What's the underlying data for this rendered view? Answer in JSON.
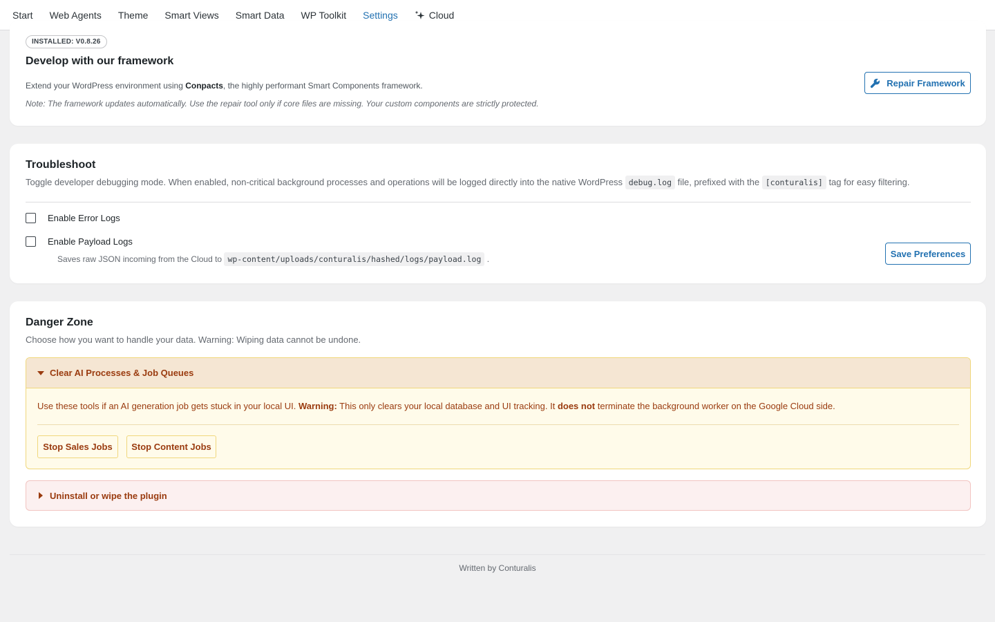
{
  "nav": {
    "tabs": [
      "Start",
      "Web Agents",
      "Theme",
      "Smart Views",
      "Smart Data",
      "WP Toolkit",
      "Settings",
      "Cloud"
    ],
    "active": "Settings",
    "cloud_icon": "sparkle-icon"
  },
  "framework": {
    "badge": "INSTALLED: V0.8.26",
    "title": "Develop with our framework",
    "desc_prefix": "Extend your WordPress environment using ",
    "desc_bold": "Conpacts",
    "desc_suffix": ", the highly performant Smart Components framework.",
    "note": "Note: The framework updates automatically. Use the repair tool only if core files are missing. Your custom components are strictly protected.",
    "repair_label": "Repair Framework",
    "repair_icon": "wrench-icon"
  },
  "troubleshoot": {
    "title": "Troubleshoot",
    "desc_1": "Toggle developer debugging mode. When enabled, non-critical background processes and operations will be logged directly into the native WordPress ",
    "code_1": "debug.log",
    "desc_2": " file, prefixed with the ",
    "code_2": "[conturalis]",
    "desc_3": " tag for easy filtering.",
    "error_logs_label": "Enable Error Logs",
    "error_logs_checked": false,
    "payload_logs_label": "Enable Payload Logs",
    "payload_logs_checked": false,
    "payload_hint_prefix": "Saves raw JSON incoming from the Cloud to ",
    "payload_hint_code": "wp-content/uploads/conturalis/hashed/logs/payload.log",
    "payload_hint_suffix": " .",
    "save_label": "Save Preferences"
  },
  "danger": {
    "title": "Danger Zone",
    "desc": "Choose how you want to handle your data. Warning: Wiping data cannot be undone.",
    "jobs_title": "Clear AI Processes & Job Queues",
    "jobs_text_1": "Use these tools if an AI generation job gets stuck in your local UI. ",
    "jobs_bold_1": "Warning:",
    "jobs_text_2": " This only clears your local database and UI tracking. It ",
    "jobs_bold_2": "does not",
    "jobs_text_3": " terminate the background worker on the Google Cloud side.",
    "stop_sales_label": "Stop Sales Jobs",
    "stop_content_label": "Stop Content Jobs",
    "uninstall_title": "Uninstall or wipe the plugin"
  },
  "footer": {
    "text": "Written by Conturalis"
  },
  "colors": {
    "accent": "#2271b1",
    "warning_text": "#9a3b0f",
    "warning_bg": "#fffbea",
    "danger_bg": "#fcf0f0"
  }
}
